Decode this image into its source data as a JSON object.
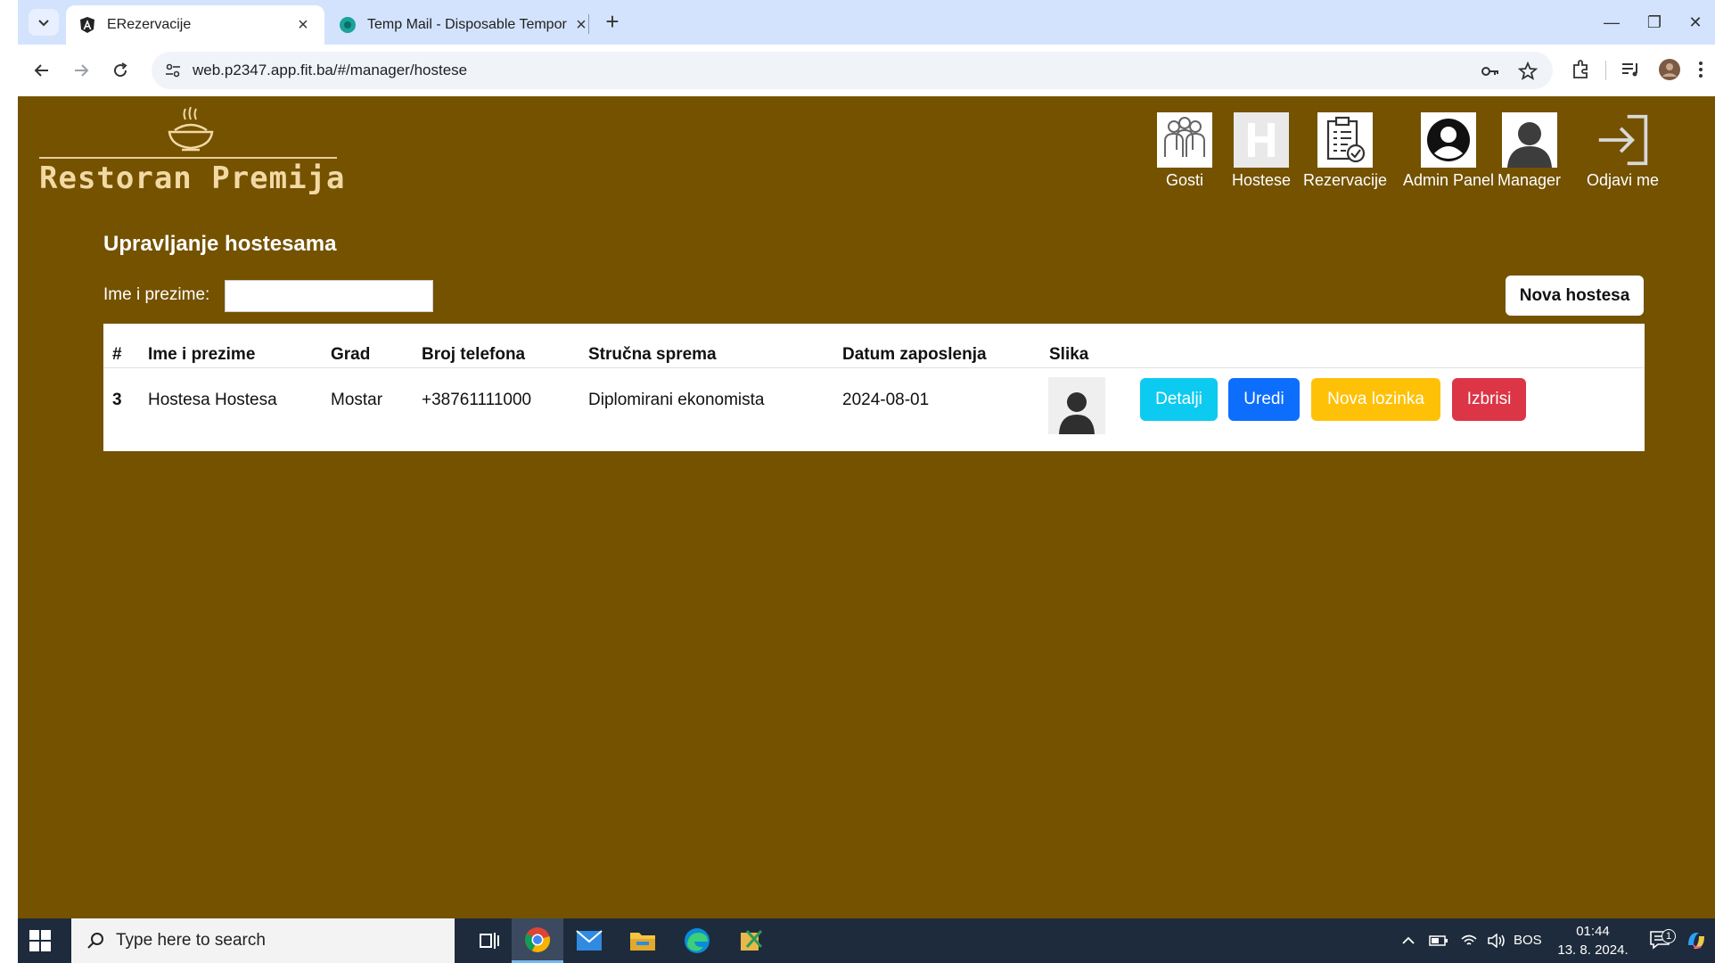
{
  "browser": {
    "tabs": [
      {
        "title": "ERezervacije",
        "active": true
      },
      {
        "title": "Temp Mail - Disposable Tempor",
        "active": false
      }
    ],
    "url": "web.p2347.app.fit.ba/#/manager/hostese"
  },
  "logo": {
    "text": "Restoran Premija"
  },
  "nav": [
    {
      "label": "Gosti",
      "icon": "people-group-icon"
    },
    {
      "label": "Hostese",
      "icon": "letter-h-icon"
    },
    {
      "label": "Rezervacije",
      "icon": "clipboard-check-icon"
    },
    {
      "label": "Admin Panel",
      "icon": "user-circle-icon"
    },
    {
      "label": "Manager",
      "icon": "user-silhouette-icon"
    },
    {
      "label": "Odjavi me",
      "icon": "sign-in-arrow-icon"
    }
  ],
  "main": {
    "title": "Upravljanje hostesama",
    "filter": {
      "label": "Ime i prezime:",
      "value": ""
    },
    "new_button": "Nova hostesa",
    "table": {
      "headers": [
        "#",
        "Ime i prezime",
        "Grad",
        "Broj telefona",
        "Stručna sprema",
        "Datum zaposlenja",
        "Slika"
      ],
      "rows": [
        {
          "id": "3",
          "name": "Hostesa Hostesa",
          "city": "Mostar",
          "phone": "+38761111000",
          "education": "Diplomirani ekonomista",
          "date": "2024-08-01"
        }
      ],
      "actions": {
        "details": "Detalji",
        "edit": "Uredi",
        "new_password": "Nova lozinka",
        "delete": "Izbrisi"
      }
    }
  },
  "colors": {
    "page_bg": "#745200",
    "details": "#0dcaf0",
    "edit": "#0d6efd",
    "new_password": "#ffc107",
    "delete": "#dc3545"
  },
  "taskbar": {
    "search_placeholder": "Type here to search",
    "language": "BOS",
    "time": "01:44",
    "date": "13. 8. 2024.",
    "notification_count": "1"
  }
}
